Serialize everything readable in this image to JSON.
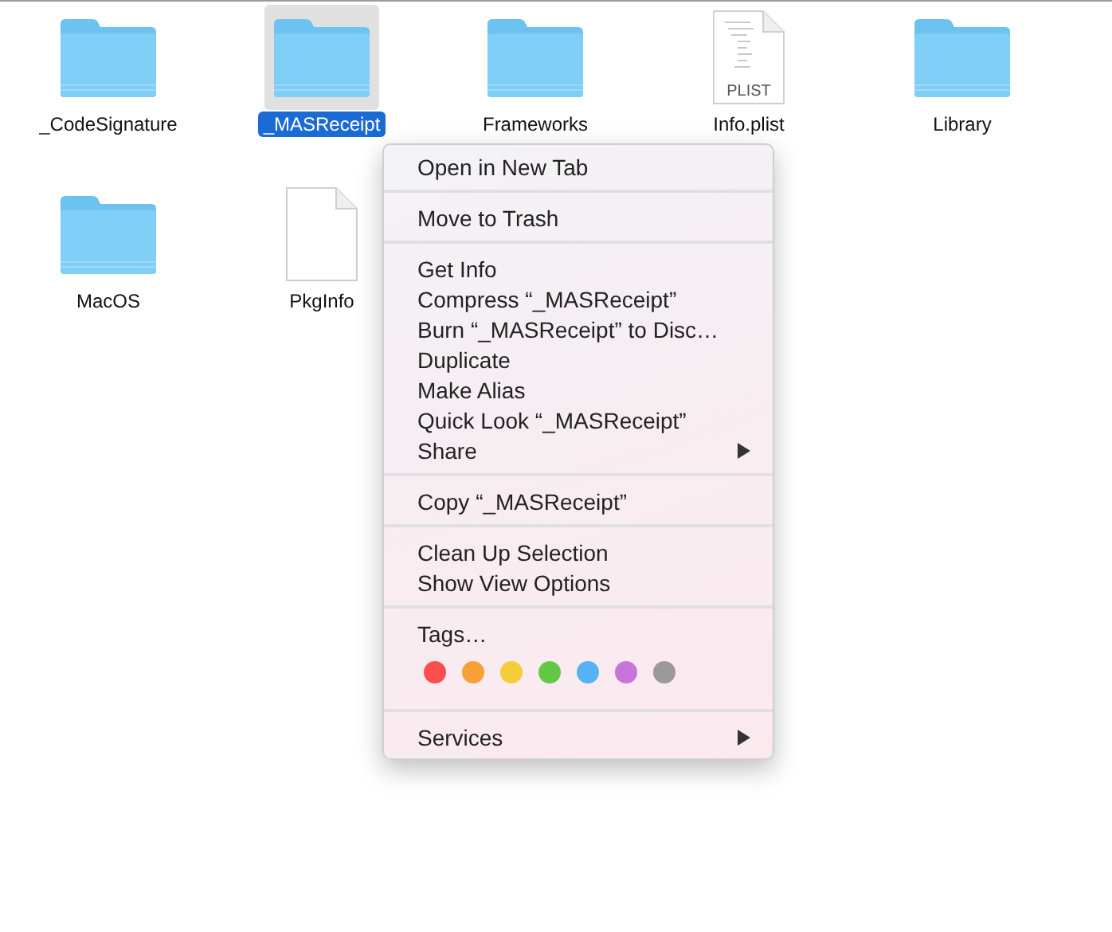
{
  "files": [
    {
      "name": "_CodeSignature",
      "kind": "folder",
      "selected": false
    },
    {
      "name": "_MASReceipt",
      "kind": "folder",
      "selected": true
    },
    {
      "name": "Frameworks",
      "kind": "folder",
      "selected": false
    },
    {
      "name": "Info.plist",
      "kind": "document",
      "badge": "PLIST",
      "selected": false
    },
    {
      "name": "Library",
      "kind": "folder",
      "selected": false
    },
    {
      "name": "MacOS",
      "kind": "folder",
      "selected": false
    },
    {
      "name": "PkgInfo",
      "kind": "document",
      "selected": false
    }
  ],
  "context_menu": {
    "sections": [
      {
        "kind": "items",
        "items": [
          {
            "label": "Open in New Tab",
            "submenu": false
          }
        ]
      },
      {
        "kind": "items",
        "items": [
          {
            "label": "Move to Trash",
            "submenu": false
          }
        ]
      },
      {
        "kind": "items",
        "items": [
          {
            "label": "Get Info",
            "submenu": false
          },
          {
            "label": "Compress “_MASReceipt”",
            "submenu": false
          },
          {
            "label": "Burn “_MASReceipt” to Disc…",
            "submenu": false
          },
          {
            "label": "Duplicate",
            "submenu": false
          },
          {
            "label": "Make Alias",
            "submenu": false
          },
          {
            "label": "Quick Look “_MASReceipt”",
            "submenu": false
          },
          {
            "label": "Share",
            "submenu": true
          }
        ]
      },
      {
        "kind": "items",
        "items": [
          {
            "label": "Copy “_MASReceipt”",
            "submenu": false
          }
        ]
      },
      {
        "kind": "items",
        "items": [
          {
            "label": "Clean Up Selection",
            "submenu": false
          },
          {
            "label": "Show View Options",
            "submenu": false
          }
        ]
      },
      {
        "kind": "tags",
        "label": "Tags…",
        "colors": [
          {
            "color": "#fc4e4e"
          },
          {
            "color": "#f6a038"
          },
          {
            "color": "#f5cc3a"
          },
          {
            "color": "#62c945"
          },
          {
            "color": "#55b2f4"
          },
          {
            "color": "#c874dd"
          },
          {
            "color": "#9a9a9a"
          }
        ]
      },
      {
        "kind": "items",
        "items": [
          {
            "label": "Services",
            "submenu": true
          }
        ]
      }
    ]
  }
}
